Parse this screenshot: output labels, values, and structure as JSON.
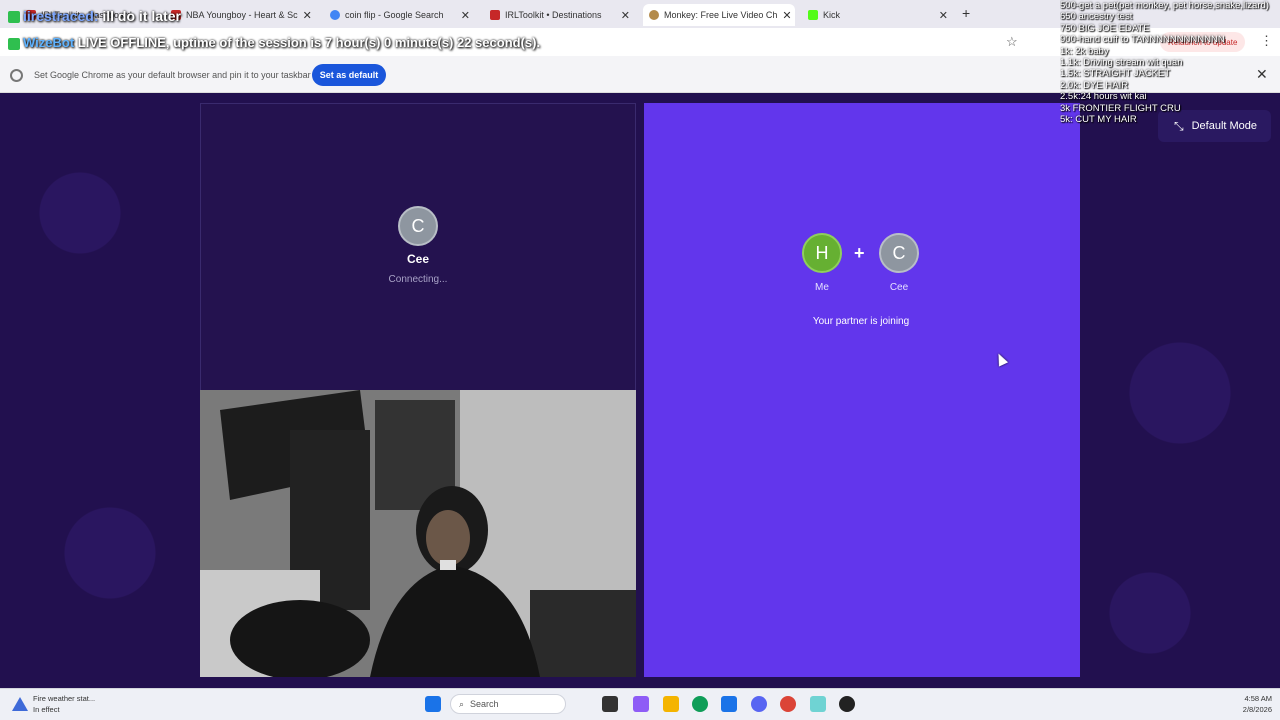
{
  "browser": {
    "tabs": [
      {
        "title": "IRLToolkit - Dashboard",
        "favicon_color": "#c62828"
      },
      {
        "title": "NBA Youngboy - Heart & Sc",
        "favicon_color": "#c62828"
      },
      {
        "title": "coin flip - Google Search",
        "favicon_color": "#4285f4"
      },
      {
        "title": "IRLToolkit • Destinations",
        "favicon_color": "#c62828"
      },
      {
        "title": "Monkey: Free Live Video Ch",
        "favicon_color": "#b38a4a"
      },
      {
        "title": "Kick",
        "favicon_color": "#53fc18"
      }
    ],
    "new_tab": "+",
    "update_button": "Relaunch to update",
    "infobar": {
      "message": "Set Google Chrome as your default browser and pin it to your taskbar",
      "button": "Set as default",
      "close": "✕"
    }
  },
  "overlay": {
    "chat_user": "iirestraced:",
    "chat_message": "ill do it later",
    "bot_name": "WizeBot",
    "bot_message": "LIVE OFFLINE, uptime of the session is 7 hour(s) 0 minute(s) 22 second(s).",
    "goals": [
      "500-get a pet(pet monkey, pet horse,snake,lizard)",
      "650 ancestry test",
      "750 BIG JOE EDATE",
      "900-hand cuff to TANNNNNNNNNNNN",
      "1k: 2k baby",
      "1.1k: Driving stream wit quan",
      "1.5k: STRAIGHT JACKET",
      "2.0k: DYE HAIR",
      "2.5k:24 hours wit kai",
      "3k FRONTIER FLIGHT CRU",
      "5k: CUT MY HAIR"
    ]
  },
  "app": {
    "mode_button": "Default Mode",
    "partner": {
      "initial": "C",
      "name": "Cee",
      "status": "Connecting..."
    },
    "match": {
      "me_initial": "H",
      "me_label": "Me",
      "plus": "+",
      "partner_initial": "C",
      "partner_label": "Cee",
      "status": "Your partner is joining"
    }
  },
  "taskbar": {
    "weather_line1": "Fire weather stat...",
    "weather_line2": "In effect",
    "search_placeholder": "Search",
    "time": "4:58 AM",
    "date": "2/8/2026"
  }
}
